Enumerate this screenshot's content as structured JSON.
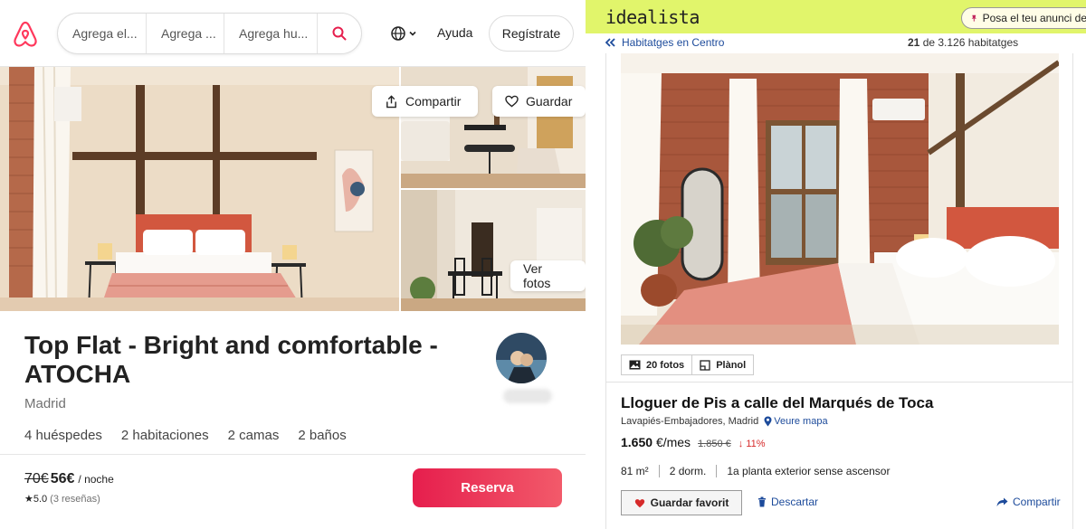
{
  "airbnb": {
    "search": {
      "where": "Agrega el...",
      "dates": "Agrega ...",
      "guests": "Agrega hu..."
    },
    "help": "Ayuda",
    "signup": "Regístrate",
    "share_label": "Compartir",
    "save_label": "Guardar",
    "photos_label": "Ver fotos",
    "title": "Top Flat - Bright and comfortable - ATOCHA",
    "city": "Madrid",
    "features": [
      "4 huéspedes",
      "2 habitaciones",
      "2 camas",
      "2 baños"
    ],
    "price_old": "70€",
    "price_new": "56€",
    "price_unit": "/ noche",
    "rating": "★5.0",
    "reviews": "(3 reseñas)",
    "reserve": "Reserva",
    "colors": {
      "brand": "#ff385c",
      "reserve": "#e61e4d"
    }
  },
  "idealista": {
    "logo": "idealista",
    "post_ad": "Posa el teu anunci de",
    "back": "Habitatges en Centro",
    "count_current": "21",
    "count_rest": " de 3.126 habitatges",
    "tab_photos": "20 fotos",
    "tab_plan": "Plànol",
    "title": "Lloguer de Pis a calle del Marqués de Toca",
    "location": "Lavapiés-Embajadores, Madrid",
    "map_link": "Veure mapa",
    "price": "1.650",
    "price_unit": "€/mes",
    "price_old": "1.850 €",
    "price_drop": "↓ 11%",
    "details": [
      "81 m²",
      "2 dorm.",
      "1a planta exterior sense ascensor"
    ],
    "fav": "Guardar favorit",
    "discard": "Descartar",
    "share": "Compartir",
    "colors": {
      "brand_bg": "#e1f56b",
      "link": "#1d4b9b",
      "drop": "#d62a2a"
    }
  }
}
